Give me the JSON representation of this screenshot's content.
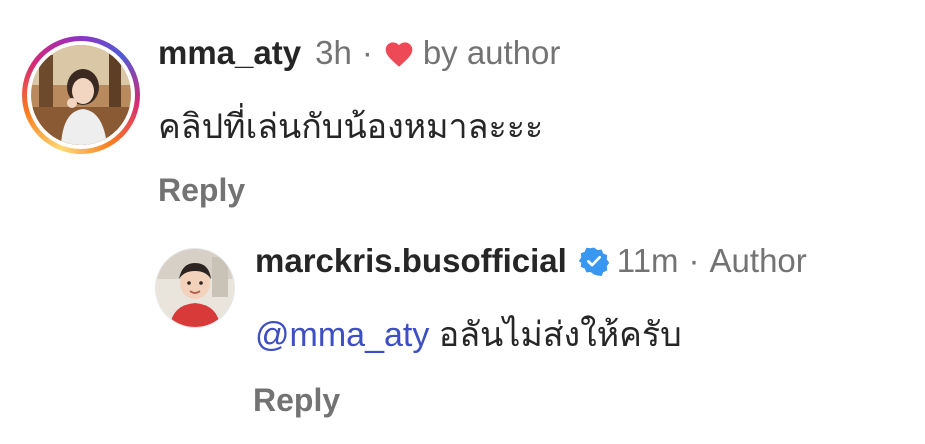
{
  "comment": {
    "username": "mma_aty",
    "time": "3h",
    "separator": "·",
    "liked_label": "by author",
    "text": "คลิปที่เล่นกับน้องหมาละะะ",
    "reply_label": "Reply",
    "avatar_story_ring": true,
    "heart_color": "#ed4956"
  },
  "reply": {
    "username": "marckris.busofficial",
    "verified": true,
    "verified_color": "#3897f0",
    "time": "11m",
    "separator": "·",
    "author_label": "Author",
    "mention": "@mma_aty",
    "text": "อลันไม่ส่งให้ครับ",
    "reply_label": "Reply"
  },
  "icons": {
    "heart": "heart-icon",
    "verified": "verified-badge-icon"
  }
}
